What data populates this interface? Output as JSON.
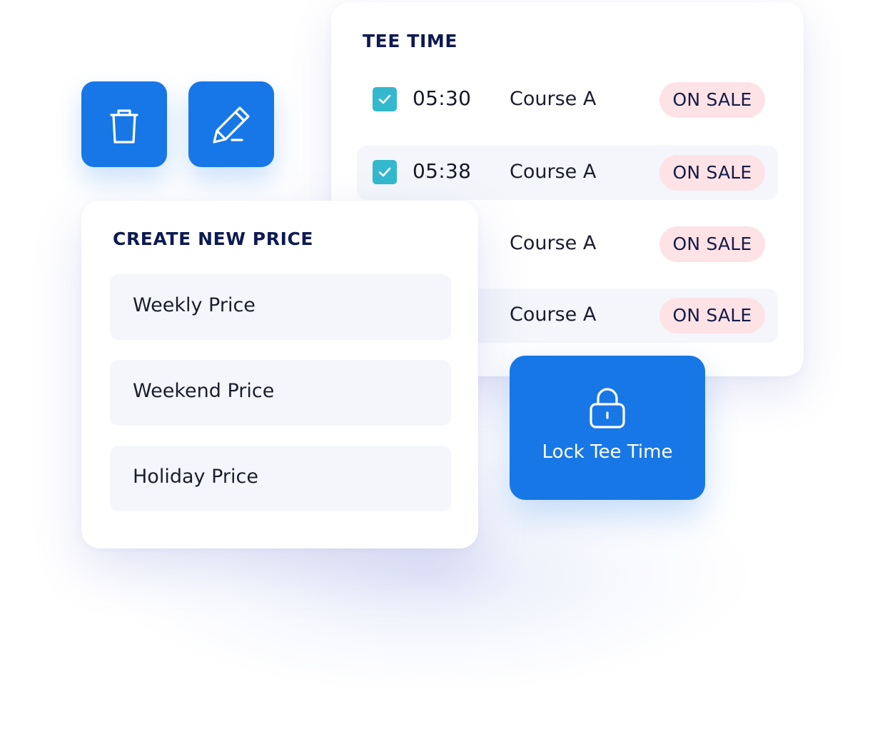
{
  "tee_time": {
    "title": "TEE TIME",
    "rows": [
      {
        "time": "05:30",
        "course": "Course A",
        "status": "ON SALE",
        "checked": true
      },
      {
        "time": "05:38",
        "course": "Course A",
        "status": "ON SALE",
        "checked": true
      },
      {
        "time": "",
        "course": "Course A",
        "status": "ON SALE",
        "checked": false
      },
      {
        "time": "",
        "course": "Course A",
        "status": "ON SALE",
        "checked": false
      }
    ]
  },
  "actions": {
    "delete_icon": "trash-icon",
    "edit_icon": "pencil-icon"
  },
  "create_price": {
    "title": "CREATE NEW PRICE",
    "options": [
      "Weekly Price",
      "Weekend Price",
      "Holiday Price"
    ]
  },
  "lock": {
    "icon": "lock-icon",
    "label": "Lock Tee Time"
  },
  "colors": {
    "primary": "#1877e6",
    "heading": "#0e1a52",
    "checkbox": "#33b8cd",
    "status_bg": "#fde3e6",
    "row_bg": "#f4f6fb"
  }
}
